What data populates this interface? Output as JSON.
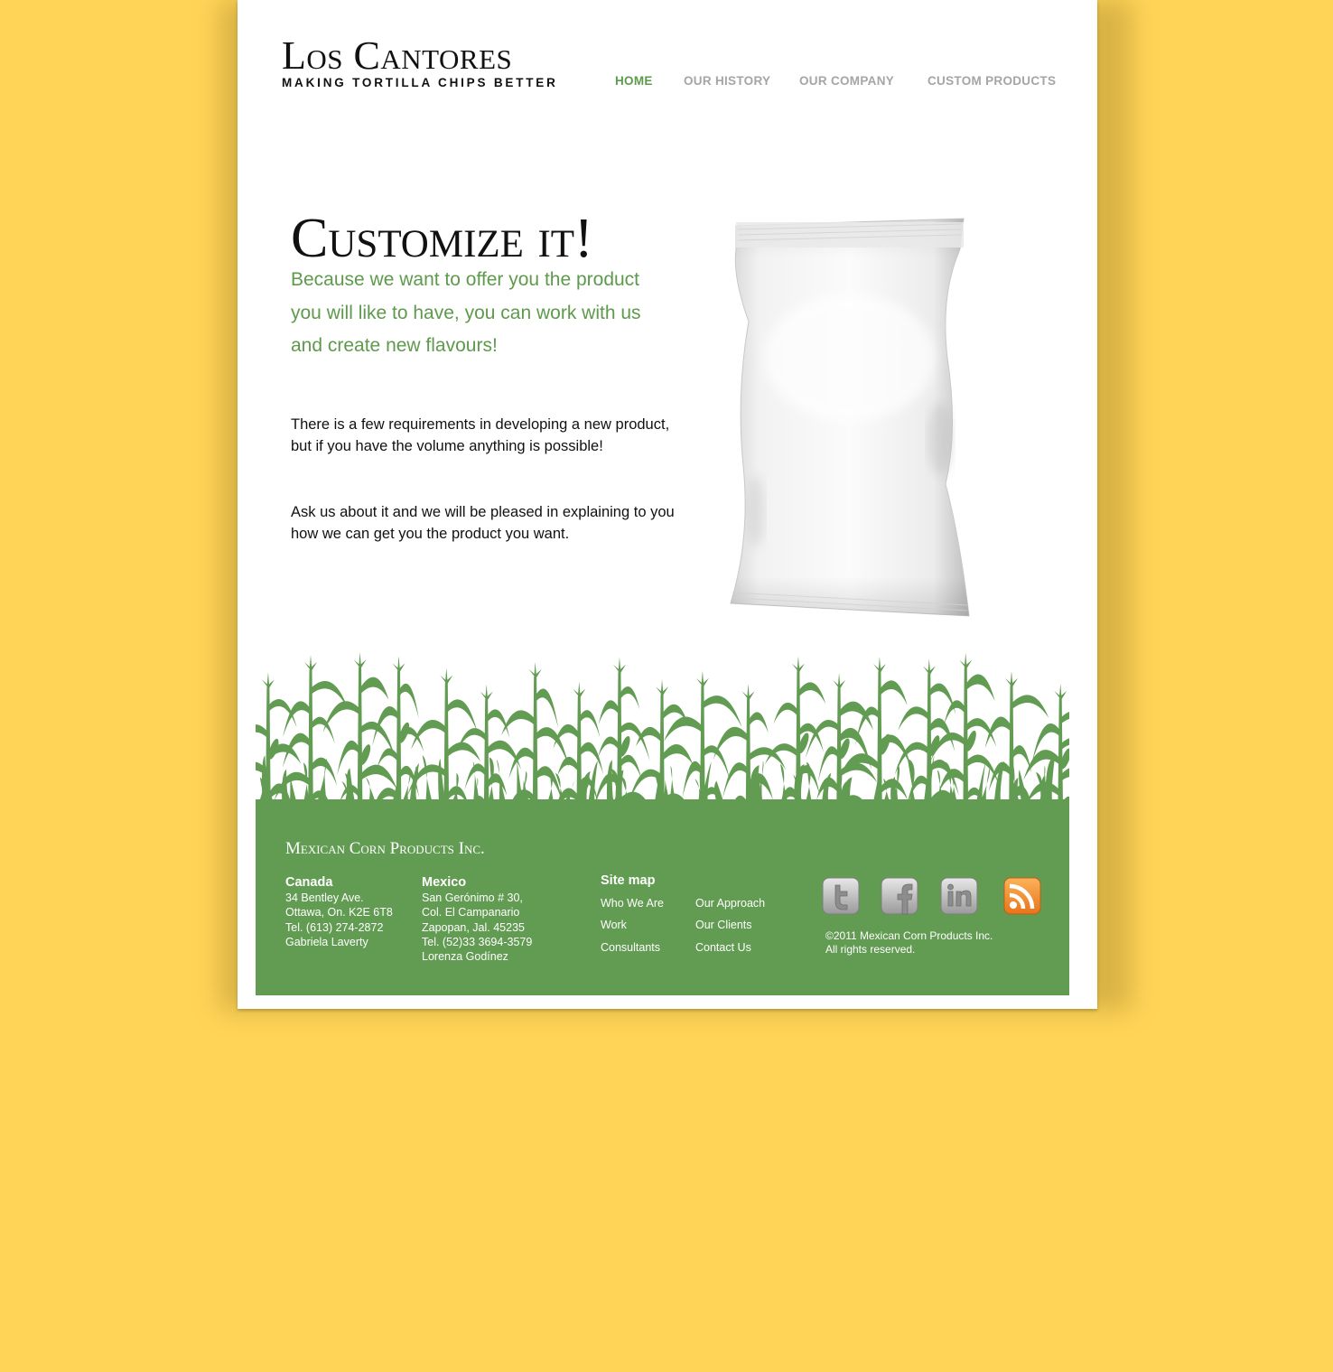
{
  "header": {
    "logo_title": "Los Cantores",
    "logo_tagline": "MAKING TORTILLA CHIPS BETTER",
    "nav": [
      {
        "label": "HOME",
        "active": true
      },
      {
        "label": "OUR HISTORY",
        "active": false
      },
      {
        "label": "OUR COMPANY",
        "active": false
      },
      {
        "label": "CUSTOM PRODUCTS",
        "active": false
      }
    ]
  },
  "main": {
    "headline": "Customize it!",
    "lead": "Because we want to offer you the product you will like to have, you can work with us and create new flavours!",
    "paragraph1": "There is a few requirements in developing a new product, but if you have the volume anything is possible!",
    "paragraph2": "Ask us about it and we will be pleased in explaining to you how we can get you the product you want."
  },
  "footer": {
    "company": "Mexican Corn Products Inc.",
    "canada": {
      "heading": "Canada",
      "lines": [
        "34 Bentley Ave.",
        "Ottawa, On. K2E 6T8",
        "Tel. (613) 274-2872",
        "Gabriela Laverty"
      ]
    },
    "mexico": {
      "heading": "Mexico",
      "lines": [
        "San Gerónimo # 30,",
        "Col. El Campanario",
        "Zapopan, Jal. 45235",
        "Tel. (52)33 3694-3579",
        "Lorenza Godínez"
      ]
    },
    "sitemap": {
      "heading": "Site map",
      "links": [
        "Who We Are",
        "Work",
        "Consultants",
        "Our Approach",
        "Our Clients",
        "Contact Us"
      ]
    },
    "social_icons": [
      "twitter-icon",
      "facebook-icon",
      "linkedin-icon",
      "rss-icon"
    ],
    "copyright": [
      "©2011 Mexican Corn Products Inc.",
      "All rights reserved."
    ]
  },
  "colors": {
    "background": "#FFD457",
    "green": "#629B52",
    "nav_active": "#5E9A4C",
    "nav_inactive": "#A5A5A5",
    "rss_orange": "#F08A24"
  }
}
